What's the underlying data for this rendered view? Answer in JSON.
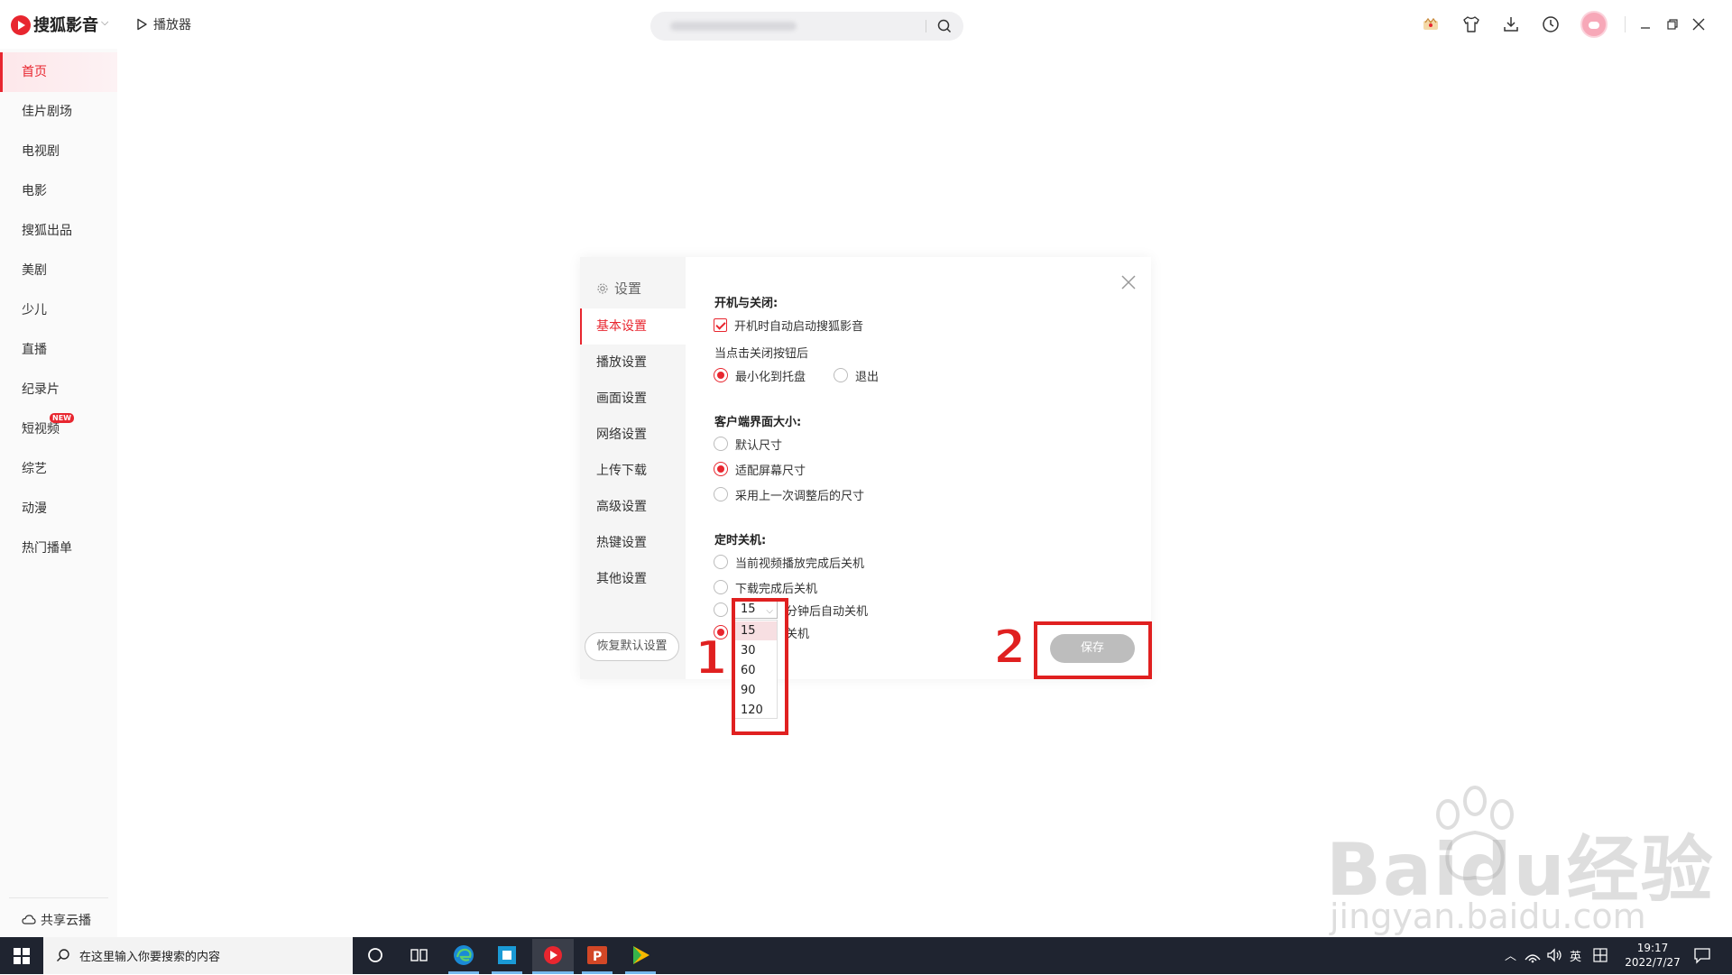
{
  "app": {
    "name": "搜狐影音",
    "player_label": "播放器",
    "search_placeholder": ""
  },
  "sidebar": {
    "items": [
      {
        "label": "首页",
        "active": true
      },
      {
        "label": "佳片剧场"
      },
      {
        "label": "电视剧"
      },
      {
        "label": "电影"
      },
      {
        "label": "搜狐出品"
      },
      {
        "label": "美剧"
      },
      {
        "label": "少儿"
      },
      {
        "label": "直播"
      },
      {
        "label": "纪录片"
      },
      {
        "label": "短视频",
        "badge": "NEW"
      },
      {
        "label": "综艺"
      },
      {
        "label": "动漫"
      },
      {
        "label": "热门播单"
      }
    ],
    "cloud_label": "共享云播"
  },
  "settings": {
    "title": "设置",
    "nav": [
      {
        "label": "基本设置",
        "active": true
      },
      {
        "label": "播放设置"
      },
      {
        "label": "画面设置"
      },
      {
        "label": "网络设置"
      },
      {
        "label": "上传下载"
      },
      {
        "label": "高级设置"
      },
      {
        "label": "热键设置"
      },
      {
        "label": "其他设置"
      }
    ],
    "restore_label": "恢复默认设置",
    "startup": {
      "title": "开机与关闭:",
      "autostart_label": "开机时自动启动搜狐影音",
      "close_label": "当点击关闭按钮后",
      "minimize_label": "最小化到托盘",
      "exit_label": "退出"
    },
    "window_size": {
      "title": "客户端界面大小:",
      "options": [
        "默认尺寸",
        "适配屏幕尺寸",
        "采用上一次调整后的尺寸"
      ],
      "selected": 1
    },
    "shutdown": {
      "title": "定时关机:",
      "opt_after_video": "当前视频播放完成后关机",
      "opt_after_download": "下载完成后关机",
      "opt_minutes_suffix": "分钟后自动关机",
      "opt_fourth_suffix": "关机",
      "selected_minutes": "15",
      "dropdown_options": [
        "15",
        "30",
        "60",
        "90",
        "120"
      ]
    },
    "save_label": "保存"
  },
  "annotations": {
    "step1": "1",
    "step2": "2",
    "color": "#e02020"
  },
  "watermark": {
    "brand": "Baidu经验",
    "url": "jingyan.baidu.com"
  },
  "taskbar": {
    "search_text": "在这里输入你要搜索的内容",
    "ime_label": "英",
    "time": "19:17",
    "date": "2022/7/27"
  },
  "colors": {
    "accent": "#e8262f",
    "taskbar": "#1f2430"
  }
}
